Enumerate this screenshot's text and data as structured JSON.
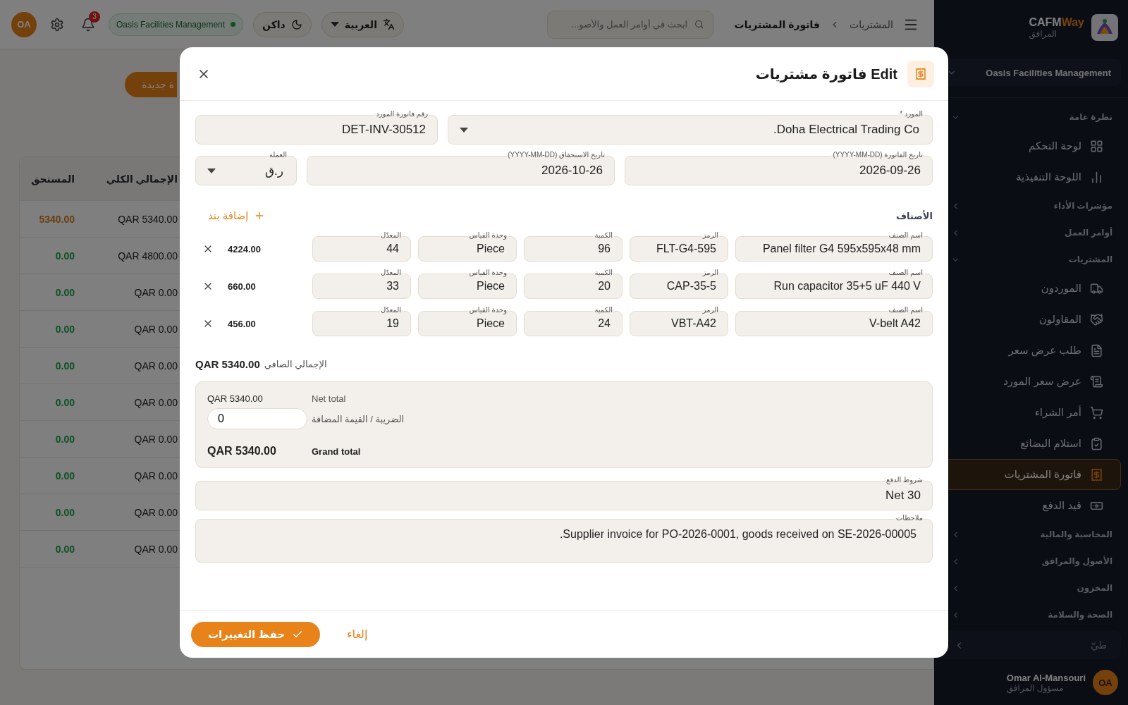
{
  "sidebar": {
    "logo": {
      "brand": "CAFM**Way**",
      "subtitle": "المرافق"
    },
    "organization": "Oasis Facilities Management",
    "sections": [
      {
        "title": "نظرة عامة",
        "expanded": true,
        "items": [
          {
            "label": "لوحة التحكم",
            "selected": false
          },
          {
            "label": "اللوحة التنفيذية",
            "selected": false
          }
        ]
      },
      {
        "title": "مؤشرات الأداء",
        "expanded": false
      },
      {
        "title": "أوامر العمل",
        "expanded": false
      },
      {
        "title": "المشتريات",
        "expanded": true,
        "items": [
          {
            "label": "الموردون",
            "selected": false
          },
          {
            "label": "المقاولون",
            "selected": false
          },
          {
            "label": "طلب عرض سعر",
            "selected": false
          },
          {
            "label": "عرض سعر المورد",
            "selected": false
          },
          {
            "label": "أمر الشراء",
            "selected": false
          },
          {
            "label": "استلام البضائع",
            "selected": false
          },
          {
            "label": "فاتورة المشتريات",
            "selected": true
          },
          {
            "label": "قيد الدفع",
            "selected": false
          }
        ]
      },
      {
        "title": "المحاسبة والمالية",
        "expanded": false
      },
      {
        "title": "الأصول والمرافق",
        "expanded": false
      },
      {
        "title": "المخزون",
        "expanded": false
      },
      {
        "title": "الصحة والسلامة",
        "expanded": false
      }
    ],
    "collapse": "طيّ",
    "user": {
      "initials": "OA",
      "name": "Omar Al-Mansouri",
      "role": "مسؤول المرافق"
    }
  },
  "topbar": {
    "breadcrumb": [
      {
        "label": "المشتريات",
        "current": false
      },
      {
        "label": "فاتورة المشتريات",
        "current": true
      }
    ],
    "search": {
      "placeholder": "ابحث في أوامر العمل والأصو..."
    },
    "language": "العربية",
    "theme": "داكن",
    "organization": "Oasis Facilities Management",
    "notifications": "3",
    "user_initials": "OA"
  },
  "page": {
    "new_button": "ة جديدة",
    "table": {
      "columns": [
        "الإجمالي الكلي",
        "المستحق"
      ],
      "rows": [
        {
          "total": "QAR 5340.00",
          "due": "5340.00",
          "paid": false
        },
        {
          "total": "QAR 4800.00",
          "due": "0.00",
          "paid": true
        },
        {
          "total": "QAR 0.00",
          "due": "0.00",
          "paid": true
        },
        {
          "total": "QAR 0.00",
          "due": "0.00",
          "paid": true
        },
        {
          "total": "QAR 0.00",
          "due": "0.00",
          "paid": true
        },
        {
          "total": "QAR 0.00",
          "due": "0.00",
          "paid": true
        },
        {
          "total": "QAR 0.00",
          "due": "0.00",
          "paid": true
        },
        {
          "total": "QAR 0.00",
          "due": "0.00",
          "paid": true
        },
        {
          "total": "QAR 0.00",
          "due": "0.00",
          "paid": true
        },
        {
          "total": "QAR 0.00",
          "due": "0.00",
          "paid": true
        }
      ]
    }
  },
  "dialog": {
    "title": "Edit فاتورة مشتريات",
    "supplier": {
      "label": "المورد *",
      "value": "Doha Electrical Trading Co."
    },
    "supplier_invoice_no": {
      "label": "رقم فاتورة المورد",
      "value": "DET-INV-30512"
    },
    "invoice_date": {
      "label": "تاريخ الفاتورة (YYYY-MM-DD)",
      "value": "2026-09-26"
    },
    "due_date": {
      "label": "تاريخ الاستحقاق (YYYY-MM-DD)",
      "value": "2026-10-26"
    },
    "currency": {
      "label": "العملة",
      "value": "ر.ق"
    },
    "items": {
      "title": "الأصناف",
      "add_button": "إضافة بند",
      "lines": [
        {
          "fields": [
            {
              "label": "اسم الصنف",
              "value": "Panel filter G4 595x595x48 mm"
            },
            {
              "label": "الرمز",
              "value": "FLT-G4-595"
            },
            {
              "label": "الكمية",
              "value": "96"
            },
            {
              "label": "وحدة القياس",
              "value": "Piece"
            },
            {
              "label": "المعدّل",
              "value": "44"
            }
          ],
          "amount": "4224.00"
        },
        {
          "fields": [
            {
              "label": "اسم الصنف",
              "value": "Run capacitor 35+5 uF 440 V"
            },
            {
              "label": "الرمز",
              "value": "CAP-35-5"
            },
            {
              "label": "الكمية",
              "value": "20"
            },
            {
              "label": "وحدة القياس",
              "value": "Piece"
            },
            {
              "label": "المعدّل",
              "value": "33"
            }
          ],
          "amount": "660.00"
        },
        {
          "fields": [
            {
              "label": "اسم الصنف",
              "value": "V-belt A42"
            },
            {
              "label": "الرمز",
              "value": "VBT-A42"
            },
            {
              "label": "الكمية",
              "value": "24"
            },
            {
              "label": "وحدة القياس",
              "value": "Piece"
            },
            {
              "label": "المعدّل",
              "value": "19"
            }
          ],
          "amount": "456.00"
        }
      ]
    },
    "net_line": {
      "label": "الإجمالي الصافي",
      "value": "QAR 5340.00"
    },
    "summary": {
      "net_label": "Net total",
      "net_value": "QAR 5340.00",
      "tax_label": "الضريبة / القيمة المضافة",
      "tax_value": "0",
      "grand_label": "Grand total",
      "grand_value": "QAR 5340.00"
    },
    "payment_terms": {
      "label": "شروط الدفع",
      "value": "Net 30"
    },
    "notes": {
      "label": "ملاحظات",
      "value": "Supplier invoice for PO-2026-0001, goods received on SE-2026-00005."
    },
    "buttons": {
      "save": "حفظ التغييرات",
      "cancel": "إلغاء"
    }
  }
}
